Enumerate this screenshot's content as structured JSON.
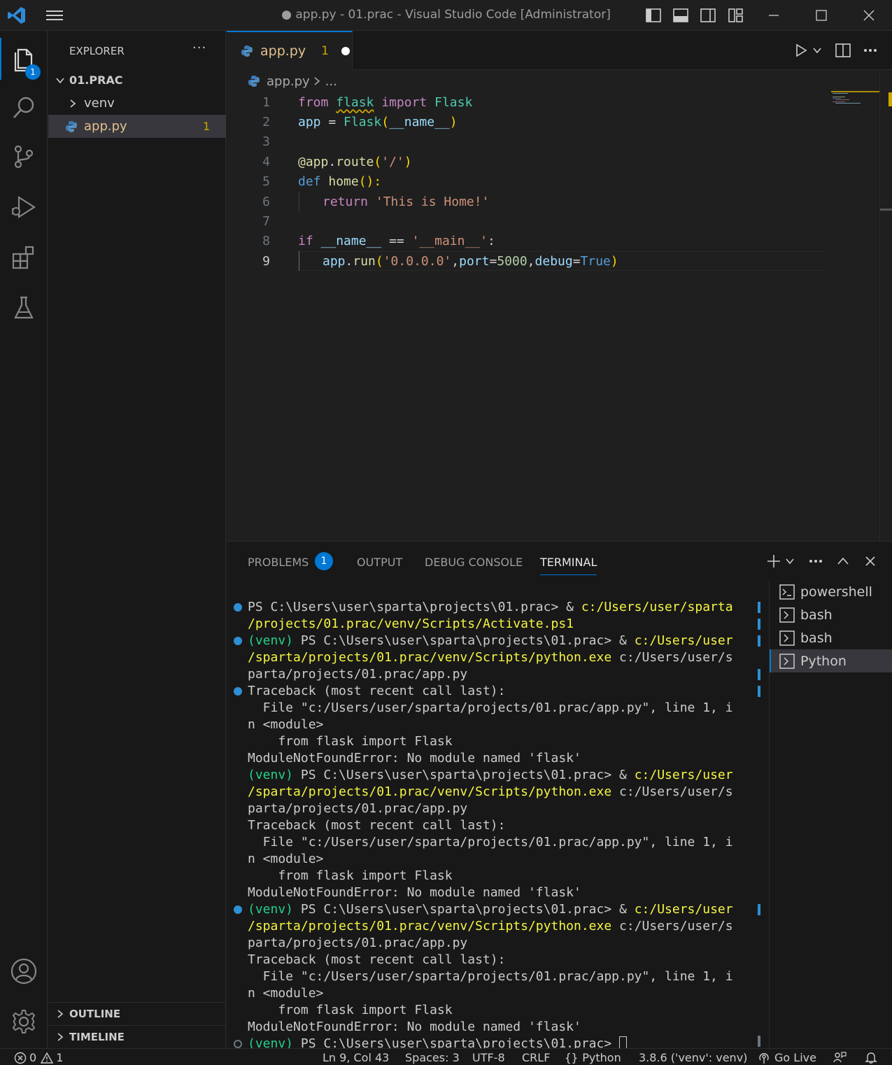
{
  "window": {
    "title": "● app.py - 01.prac - Visual Studio Code [Administrator]"
  },
  "activity_bar": {
    "explorer_badge": "1",
    "icons": [
      "files-icon",
      "search-icon",
      "source-control-icon",
      "run-debug-icon",
      "extensions-icon",
      "testing-icon",
      "account-icon",
      "settings-gear-icon"
    ]
  },
  "sidebar": {
    "title": "EXPLORER",
    "more": "···",
    "folder": "01.PRAC",
    "items": [
      {
        "label": "venv",
        "type": "folder"
      },
      {
        "label": "app.py",
        "type": "file",
        "badge": "1"
      }
    ],
    "outline": "OUTLINE",
    "timeline": "TIMELINE"
  },
  "editor": {
    "tab": {
      "label": "app.py",
      "problems": "1"
    },
    "breadcrumb": {
      "file": "app.py",
      "rest": "..."
    },
    "lines": [
      "1",
      "2",
      "3",
      "4",
      "5",
      "6",
      "7",
      "8",
      "9"
    ],
    "current_line": "9",
    "code": {
      "l1": [
        "from",
        " ",
        "flask",
        " ",
        "import",
        " ",
        "Flask"
      ],
      "l2": [
        "app",
        " = ",
        "Flask",
        "(",
        "__name__",
        ")"
      ],
      "l4": [
        "@app",
        ".",
        "route",
        "(",
        "'/'",
        ")"
      ],
      "l5": [
        "def",
        " ",
        "home",
        "():"
      ],
      "l6": [
        "return",
        " ",
        "'This is Home!'"
      ],
      "l8": [
        "if",
        " ",
        "__name__",
        " == ",
        "'__main__'",
        ":"
      ],
      "l9": [
        "app",
        ".",
        "run",
        "(",
        "'0.0.0.0'",
        ",",
        "port",
        "=",
        "5000",
        ",",
        "debug",
        "=",
        "True",
        ")"
      ]
    }
  },
  "panel": {
    "tabs": [
      "PROBLEMS",
      "OUTPUT",
      "DEBUG CONSOLE",
      "TERMINAL"
    ],
    "problems_badge": "1",
    "active_tab": "TERMINAL",
    "terminal_lines": [
      {
        "parts": [
          {
            "t": "PS C:\\Users\\user\\sparta\\projects\\01.prac> & ",
            "c": ""
          },
          {
            "t": "c:/Users/user/sparta",
            "c": "yel"
          }
        ]
      },
      {
        "parts": [
          {
            "t": "/projects/01.prac/venv/Scripts/Activate.ps1",
            "c": "yel"
          }
        ]
      },
      {
        "parts": [
          {
            "t": "(venv)",
            "c": "grn"
          },
          {
            "t": " PS C:\\Users\\user\\sparta\\projects\\01.prac> & ",
            "c": ""
          },
          {
            "t": "c:/Users/user",
            "c": "yel"
          }
        ]
      },
      {
        "parts": [
          {
            "t": "/sparta/projects/01.prac/venv/Scripts/python.exe",
            "c": "yel"
          },
          {
            "t": " c:/Users/user/s",
            "c": ""
          }
        ]
      },
      {
        "parts": [
          {
            "t": "parta/projects/01.prac/app.py",
            "c": ""
          }
        ]
      },
      {
        "parts": [
          {
            "t": "Traceback (most recent call last):",
            "c": ""
          }
        ]
      },
      {
        "parts": [
          {
            "t": "  File \"c:/Users/user/sparta/projects/01.prac/app.py\", line 1, i",
            "c": ""
          }
        ]
      },
      {
        "parts": [
          {
            "t": "n <module>",
            "c": ""
          }
        ]
      },
      {
        "parts": [
          {
            "t": "    from flask import Flask",
            "c": ""
          }
        ]
      },
      {
        "parts": [
          {
            "t": "ModuleNotFoundError: No module named 'flask'",
            "c": ""
          }
        ]
      },
      {
        "parts": [
          {
            "t": "(venv)",
            "c": "grn"
          },
          {
            "t": " PS C:\\Users\\user\\sparta\\projects\\01.prac> & ",
            "c": ""
          },
          {
            "t": "c:/Users/user",
            "c": "yel"
          }
        ]
      },
      {
        "parts": [
          {
            "t": "/sparta/projects/01.prac/venv/Scripts/python.exe",
            "c": "yel"
          },
          {
            "t": " c:/Users/user/s",
            "c": ""
          }
        ]
      },
      {
        "parts": [
          {
            "t": "parta/projects/01.prac/app.py",
            "c": ""
          }
        ]
      },
      {
        "parts": [
          {
            "t": "Traceback (most recent call last):",
            "c": ""
          }
        ]
      },
      {
        "parts": [
          {
            "t": "  File \"c:/Users/user/sparta/projects/01.prac/app.py\", line 1, i",
            "c": ""
          }
        ]
      },
      {
        "parts": [
          {
            "t": "n <module>",
            "c": ""
          }
        ]
      },
      {
        "parts": [
          {
            "t": "    from flask import Flask",
            "c": ""
          }
        ]
      },
      {
        "parts": [
          {
            "t": "ModuleNotFoundError: No module named 'flask'",
            "c": ""
          }
        ]
      },
      {
        "parts": [
          {
            "t": "(venv)",
            "c": "grn"
          },
          {
            "t": " PS C:\\Users\\user\\sparta\\projects\\01.prac> & ",
            "c": ""
          },
          {
            "t": "c:/Users/user",
            "c": "yel"
          }
        ]
      },
      {
        "parts": [
          {
            "t": "/sparta/projects/01.prac/venv/Scripts/python.exe",
            "c": "yel"
          },
          {
            "t": " c:/Users/user/s",
            "c": ""
          }
        ]
      },
      {
        "parts": [
          {
            "t": "parta/projects/01.prac/app.py",
            "c": ""
          }
        ]
      },
      {
        "parts": [
          {
            "t": "Traceback (most recent call last):",
            "c": ""
          }
        ]
      },
      {
        "parts": [
          {
            "t": "  File \"c:/Users/user/sparta/projects/01.prac/app.py\", line 1, i",
            "c": ""
          }
        ]
      },
      {
        "parts": [
          {
            "t": "n <module>",
            "c": ""
          }
        ]
      },
      {
        "parts": [
          {
            "t": "    from flask import Flask",
            "c": ""
          }
        ]
      },
      {
        "parts": [
          {
            "t": "ModuleNotFoundError: No module named 'flask'",
            "c": ""
          }
        ]
      },
      {
        "parts": [
          {
            "t": "(venv)",
            "c": "grn"
          },
          {
            "t": " PS C:\\Users\\user\\sparta\\projects\\01.prac> ",
            "c": ""
          }
        ]
      }
    ],
    "terminal_markers": [
      "blue",
      "none",
      "blue",
      "none",
      "none",
      "blue",
      "none",
      "none",
      "none",
      "none",
      "none",
      "none",
      "none",
      "none",
      "none",
      "none",
      "none",
      "none",
      "blue",
      "none",
      "none",
      "none",
      "none",
      "none",
      "none",
      "none",
      "hollow"
    ],
    "terminals": [
      {
        "label": "powershell",
        "selected": false
      },
      {
        "label": "bash",
        "selected": false
      },
      {
        "label": "bash",
        "selected": false
      },
      {
        "label": "Python",
        "selected": true
      }
    ]
  },
  "status_bar": {
    "errors": "0",
    "warnings": "1",
    "position": "Ln 9, Col 43",
    "spaces": "Spaces: 3",
    "encoding": "UTF-8",
    "eol": "CRLF",
    "language": "Python",
    "interpreter": "3.8.6 ('venv': venv)",
    "go_live": "Go Live"
  },
  "colors": {
    "accent": "#0078d4",
    "warning": "#cca700",
    "modified_file": "#e2c08d"
  }
}
